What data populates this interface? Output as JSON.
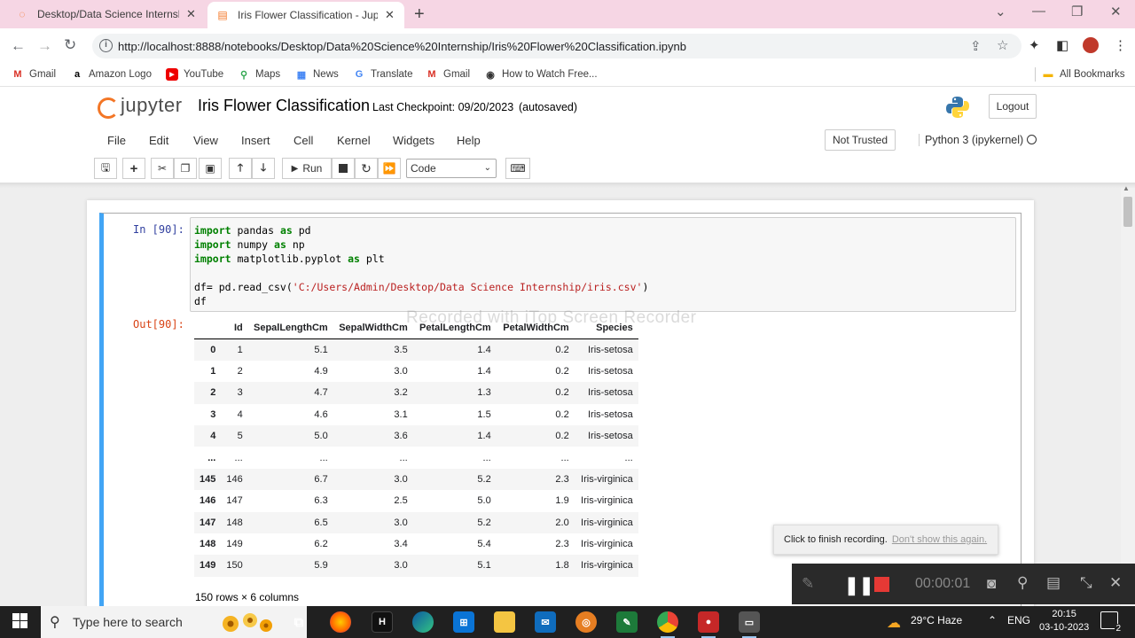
{
  "browser": {
    "tabs": [
      {
        "label": "Desktop/Data Science Internship",
        "active": false
      },
      {
        "label": "Iris Flower Classification - Jupyter",
        "active": true
      }
    ],
    "url": "http://localhost:8888/notebooks/Desktop/Data%20Science%20Internship/Iris%20Flower%20Classification.ipynb",
    "bookmarks": [
      "Gmail",
      "Amazon Logo",
      "YouTube",
      "Maps",
      "News",
      "Translate",
      "Gmail",
      "How to Watch Free..."
    ],
    "all_bookmarks": "All Bookmarks"
  },
  "jupyter": {
    "logo_text": "jupyter",
    "notebook_title": "Iris Flower Classification",
    "checkpoint": "Last Checkpoint: 09/20/2023",
    "autosaved": "(autosaved)",
    "logout": "Logout",
    "menu": [
      "File",
      "Edit",
      "View",
      "Insert",
      "Cell",
      "Kernel",
      "Widgets",
      "Help"
    ],
    "trust": "Not Trusted",
    "kernel": "Python 3 (ipykernel)",
    "run_label": "Run",
    "cell_type": "Code"
  },
  "cell": {
    "in_prompt": "In [90]:",
    "out_prompt": "Out[90]:",
    "code": [
      [
        [
          "kw",
          "import"
        ],
        [
          "",
          "pandas "
        ],
        [
          "kw",
          "as"
        ],
        [
          "",
          "pd"
        ]
      ],
      [
        [
          "kw",
          "import"
        ],
        [
          "",
          "numpy "
        ],
        [
          "kw",
          "as"
        ],
        [
          "",
          "np"
        ]
      ],
      [
        [
          "kw",
          "import"
        ],
        [
          "",
          "matplotlib.pyplot "
        ],
        [
          "kw",
          "as"
        ],
        [
          "",
          "plt"
        ]
      ],
      [],
      [
        [
          "",
          "df= pd.read_csv("
        ],
        [
          "str",
          "'C:/Users/Admin/Desktop/Data Science Internship/iris.csv'"
        ],
        [
          "",
          ")"
        ]
      ],
      [
        [
          "",
          "df"
        ]
      ]
    ],
    "table": {
      "columns": [
        "",
        "Id",
        "SepalLengthCm",
        "SepalWidthCm",
        "PetalLengthCm",
        "PetalWidthCm",
        "Species"
      ],
      "rows": [
        [
          "0",
          "1",
          "5.1",
          "3.5",
          "1.4",
          "0.2",
          "Iris-setosa"
        ],
        [
          "1",
          "2",
          "4.9",
          "3.0",
          "1.4",
          "0.2",
          "Iris-setosa"
        ],
        [
          "2",
          "3",
          "4.7",
          "3.2",
          "1.3",
          "0.2",
          "Iris-setosa"
        ],
        [
          "3",
          "4",
          "4.6",
          "3.1",
          "1.5",
          "0.2",
          "Iris-setosa"
        ],
        [
          "4",
          "5",
          "5.0",
          "3.6",
          "1.4",
          "0.2",
          "Iris-setosa"
        ],
        [
          "...",
          "...",
          "...",
          "...",
          "...",
          "...",
          "..."
        ],
        [
          "145",
          "146",
          "6.7",
          "3.0",
          "5.2",
          "2.3",
          "Iris-virginica"
        ],
        [
          "146",
          "147",
          "6.3",
          "2.5",
          "5.0",
          "1.9",
          "Iris-virginica"
        ],
        [
          "147",
          "148",
          "6.5",
          "3.0",
          "5.2",
          "2.0",
          "Iris-virginica"
        ],
        [
          "148",
          "149",
          "6.2",
          "3.4",
          "5.4",
          "2.3",
          "Iris-virginica"
        ],
        [
          "149",
          "150",
          "5.9",
          "3.0",
          "5.1",
          "1.8",
          "Iris-virginica"
        ]
      ],
      "shape": "150 rows × 6 columns"
    }
  },
  "recorder": {
    "watermark": "Recorded with iTop Screen Recorder",
    "tip_text": "Click to finish recording.",
    "tip_link": "Don't show this again.",
    "time": "00:00:01"
  },
  "taskbar": {
    "search_placeholder": "Type here to search",
    "weather": "29°C  Haze",
    "language": "ENG",
    "time": "20:15",
    "date": "03-10-2023",
    "notifications": "2"
  },
  "colors": {
    "tabbar": "#f6d6e4",
    "jupyter_orange": "#f37626",
    "selected_cell": "#42a5f5",
    "in_prompt": "#303f9f",
    "out_prompt": "#d84315",
    "record_red": "#e53935"
  }
}
